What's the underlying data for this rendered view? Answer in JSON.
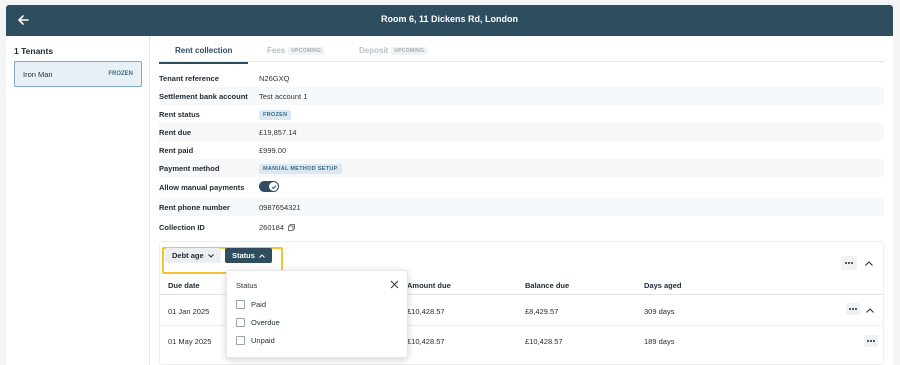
{
  "header": {
    "title": "Room 6, 11 Dickens Rd, London",
    "back_icon": "arrow-left-icon"
  },
  "sidebar": {
    "heading": "1 Tenants",
    "tenants": [
      {
        "name": "Iron Man",
        "status": "FROZEN"
      }
    ]
  },
  "tabs": [
    {
      "label": "Rent collection",
      "active": true
    },
    {
      "label": "Fees",
      "pill": "UPCOMING",
      "active": false
    },
    {
      "label": "Deposit",
      "pill": "UPCOMING",
      "active": false
    }
  ],
  "details": [
    {
      "label": "Tenant reference",
      "value": "N26GXQ"
    },
    {
      "label": "Settlement bank account",
      "value": "Test account 1"
    },
    {
      "label": "Rent status",
      "tag": "FROZEN"
    },
    {
      "label": "Rent due",
      "value": "£19,857.14"
    },
    {
      "label": "Rent paid",
      "value": "£999.00"
    },
    {
      "label": "Payment method",
      "tag": "MANUAL METHOD SETUP"
    },
    {
      "label": "Allow manual payments",
      "toggle_on": true
    },
    {
      "label": "Rent phone number",
      "value": "0987654321"
    },
    {
      "label": "Collection ID",
      "value": "260184"
    }
  ],
  "filters": {
    "debt_age": "Debt age",
    "status": "Status"
  },
  "table": {
    "columns": [
      "Due date",
      "Amount due",
      "Balance due",
      "Days aged"
    ],
    "rows": [
      {
        "due_date": "01 Jan 2025",
        "amount_due": "£10,428.57",
        "balance_due": "£8,429.57",
        "days_aged": "309 days"
      },
      {
        "due_date": "01 May 2025",
        "amount_due": "£10,428.57",
        "balance_due": "£10,428.57",
        "days_aged": "189 days"
      }
    ]
  },
  "status_dropdown": {
    "title": "Status",
    "options": [
      {
        "label": "Paid",
        "checked": false
      },
      {
        "label": "Overdue",
        "checked": false
      },
      {
        "label": "Unpaid",
        "checked": false
      }
    ]
  },
  "colors": {
    "primary": "#2e4d5f",
    "highlight": "#f4c430",
    "tag_bg": "#dbe8f2"
  }
}
